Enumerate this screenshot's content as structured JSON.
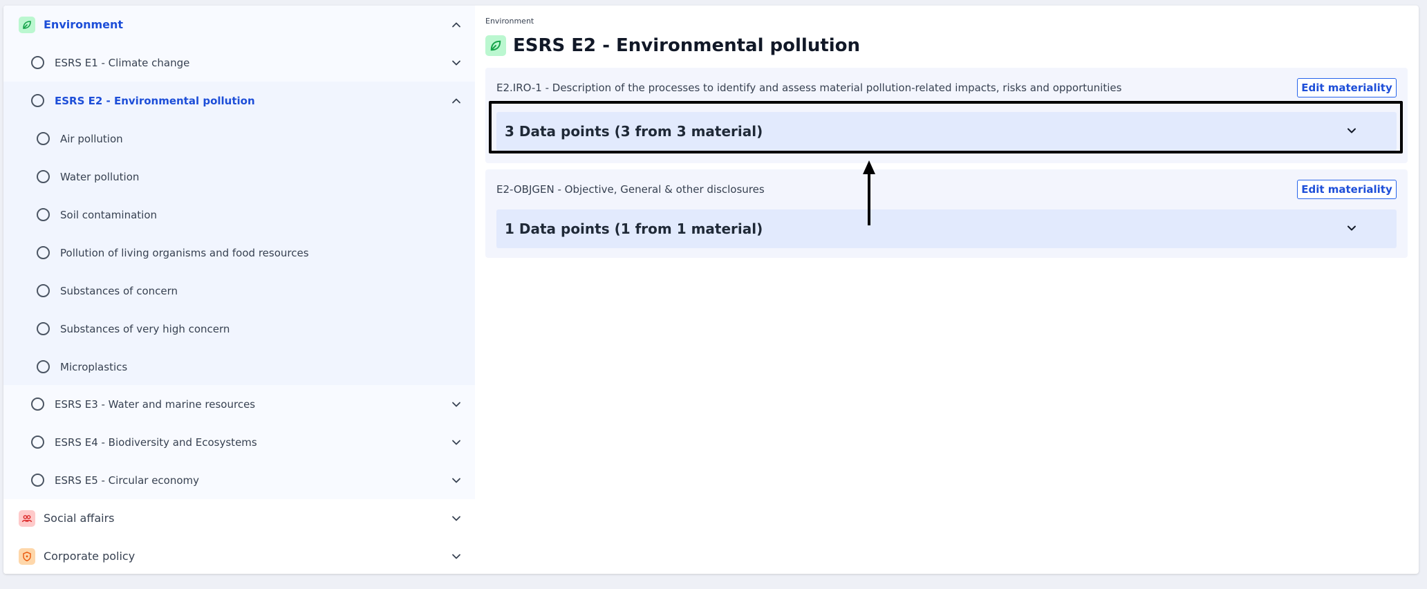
{
  "sidebar": {
    "categories": [
      {
        "label": "Environment",
        "icon": "leaf-icon",
        "icon_bg": "#bbf7d0",
        "icon_fg": "#16a34a"
      },
      {
        "label": "Social affairs",
        "icon": "people-icon",
        "icon_bg": "#fecaca",
        "icon_fg": "#dc2626"
      },
      {
        "label": "Corporate policy",
        "icon": "shield-icon",
        "icon_bg": "#fed7aa",
        "icon_fg": "#ea580c"
      }
    ],
    "standards": [
      {
        "label": "ESRS E1 - Climate change"
      },
      {
        "label": "ESRS E2 - Environmental pollution"
      },
      {
        "label": "ESRS E3 - Water and marine resources"
      },
      {
        "label": "ESRS E4 - Biodiversity and Ecosystems"
      },
      {
        "label": "ESRS E5 - Circular economy"
      }
    ],
    "topics": [
      {
        "label": "Air pollution"
      },
      {
        "label": "Water pollution"
      },
      {
        "label": "Soil contamination"
      },
      {
        "label": "Pollution of living organisms and food resources"
      },
      {
        "label": "Substances of concern"
      },
      {
        "label": "Substances of very high concern"
      },
      {
        "label": "Microplastics"
      }
    ]
  },
  "main": {
    "breadcrumb": "Environment",
    "title": "ESRS E2 - Environmental pollution",
    "cards": [
      {
        "label": "E2.IRO-1 - Description of the processes to identify and assess material pollution-related impacts, risks and opportunities",
        "button": "Edit materiality",
        "datapoints": "3 Data points (3 from 3 material)"
      },
      {
        "label": "E2-OBJGEN - Objective, General & other disclosures",
        "button": "Edit materiality",
        "datapoints": "1 Data points (1 from 1 material)"
      }
    ]
  },
  "colors": {
    "accent": "#1d4ed8",
    "highlight": "#000000"
  }
}
